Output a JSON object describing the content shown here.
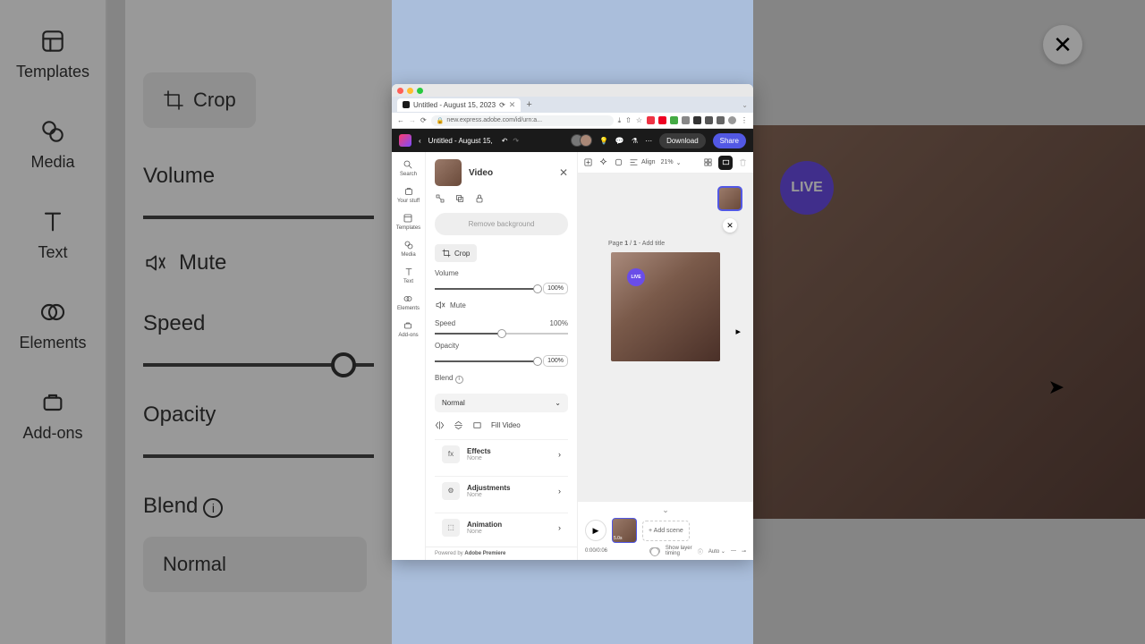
{
  "bg": {
    "side": [
      {
        "label": "Templates"
      },
      {
        "label": "Media"
      },
      {
        "label": "Text"
      },
      {
        "label": "Elements"
      },
      {
        "label": "Add-ons"
      }
    ],
    "crop": "Crop",
    "volume": "Volume",
    "mute": "Mute",
    "speed": "Speed",
    "opacity": "Opacity",
    "blend": "Blend",
    "blend_value": "Normal",
    "page_title": "/ 1 - Add title"
  },
  "browser": {
    "tab_title": "Untitled - August 15, 2023",
    "url": "new.express.adobe.com/id/urn:a..."
  },
  "appbar": {
    "doc_title": "Untitled - August 15,",
    "download": "Download",
    "share": "Share"
  },
  "rail": [
    {
      "label": "Search"
    },
    {
      "label": "Your stuff"
    },
    {
      "label": "Templates"
    },
    {
      "label": "Media"
    },
    {
      "label": "Text"
    },
    {
      "label": "Elements"
    },
    {
      "label": "Add-ons"
    }
  ],
  "panel": {
    "title": "Video",
    "remove_bg": "Remove background",
    "crop": "Crop",
    "volume": {
      "label": "Volume",
      "value": "100%",
      "pct": 100
    },
    "mute": "Mute",
    "speed": {
      "label": "Speed",
      "value": "100%",
      "pct": 50
    },
    "opacity": {
      "label": "Opacity",
      "value": "100%",
      "pct": 100
    },
    "blend": {
      "label": "Blend",
      "value": "Normal"
    },
    "fill_video": "Fill Video",
    "rows": [
      {
        "icon": "fx",
        "name": "Effects",
        "sub": "None"
      },
      {
        "icon": "⚙",
        "name": "Adjustments",
        "sub": "None"
      },
      {
        "icon": "⬚",
        "name": "Animation",
        "sub": "None"
      }
    ],
    "powered_prefix": "Powered by ",
    "powered_brand": "Adobe Premiere"
  },
  "canvas": {
    "align": "Align",
    "zoom": "21%",
    "page_label_prefix": "Page ",
    "page_current": "1",
    "page_sep": " / ",
    "page_total": "1",
    "page_suffix": " - ",
    "page_add": "Add title",
    "live": "LIVE"
  },
  "timeline": {
    "clip_duration": "5.0s",
    "add_scene": "+ Add scene",
    "time": "0:00/0:06",
    "layer_timing": "Show layer timing",
    "auto": "Auto"
  }
}
